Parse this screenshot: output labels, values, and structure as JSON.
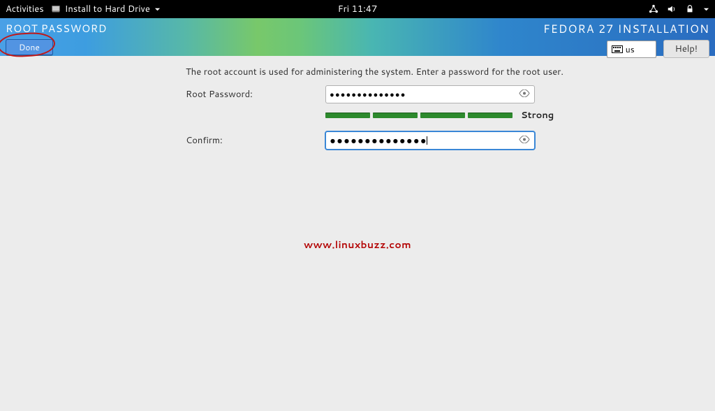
{
  "gnome_bar": {
    "activities": "Activities",
    "app_name": "Install to Hard Drive",
    "clock": "Fri 11:47"
  },
  "header": {
    "page_title": "ROOT PASSWORD",
    "done_label": "Done",
    "installer_name": "FEDORA 27 INSTALLATION",
    "keyboard_layout": "us",
    "help_label": "Help!"
  },
  "body": {
    "intro": "The root account is used for administering the system.  Enter a password for the root user.",
    "root_password_label": "Root Password:",
    "confirm_label": "Confirm:",
    "root_password_dots": "●●●●●●●●●●●●●●",
    "confirm_dots": "●●●●●●●●●●●●●●",
    "strength_text": "Strong"
  },
  "watermark": "www.linuxbuzz.com"
}
